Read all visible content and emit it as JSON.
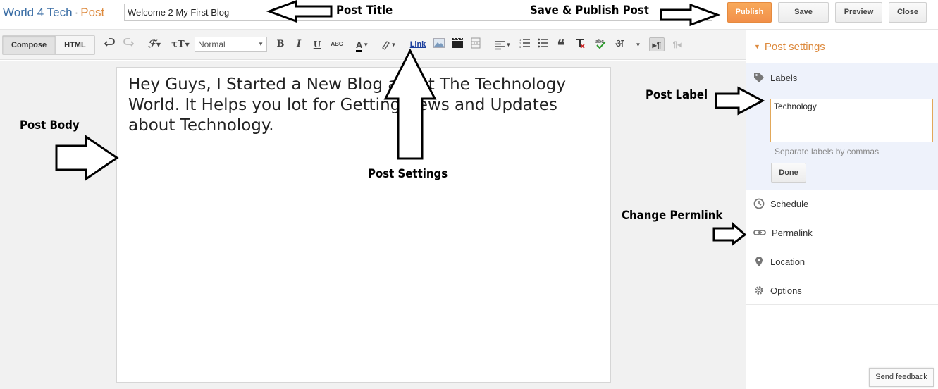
{
  "header": {
    "blog_name": "World 4 Tech",
    "separator": "·",
    "section": "Post",
    "post_title": "Welcome 2 My First Blog",
    "buttons": {
      "publish": "Publish",
      "save": "Save",
      "preview": "Preview",
      "close": "Close"
    }
  },
  "toolbar": {
    "tabs": [
      "Compose",
      "HTML"
    ],
    "format_select": "Normal",
    "link_label": "Link",
    "bold": "B",
    "italic": "I",
    "underline": "U",
    "strike": "ABC",
    "text_color": "A",
    "hindi": "अ",
    "paragraph_mark": "¶"
  },
  "post_body": "Hey Guys, I Started a New Blog about The Technology World. It Helps you lot for Getting News and Updates about Technology.",
  "sidebar": {
    "header": "Post settings",
    "labels": {
      "title": "Labels",
      "value": "Technology",
      "hint": "Separate labels by commas",
      "done": "Done"
    },
    "items": [
      {
        "label": "Schedule",
        "icon": "clock-icon"
      },
      {
        "label": "Permalink",
        "icon": "link-icon"
      },
      {
        "label": "Location",
        "icon": "location-pin-icon"
      },
      {
        "label": "Options",
        "icon": "gear-icon"
      }
    ]
  },
  "feedback": "Send feedback",
  "annotations": {
    "post_title": "Post Title",
    "save_publish": "Save & Publish Post",
    "post_body": "Post Body",
    "post_settings": "Post Settings",
    "post_label": "Post Label",
    "change_permlink": "Change Permlink"
  },
  "colors": {
    "brand_blue": "#3b6ea5",
    "accent_orange": "#dd8a3e",
    "publish_orange": "#f2904a",
    "labels_panel_bg": "#eef2fb"
  }
}
